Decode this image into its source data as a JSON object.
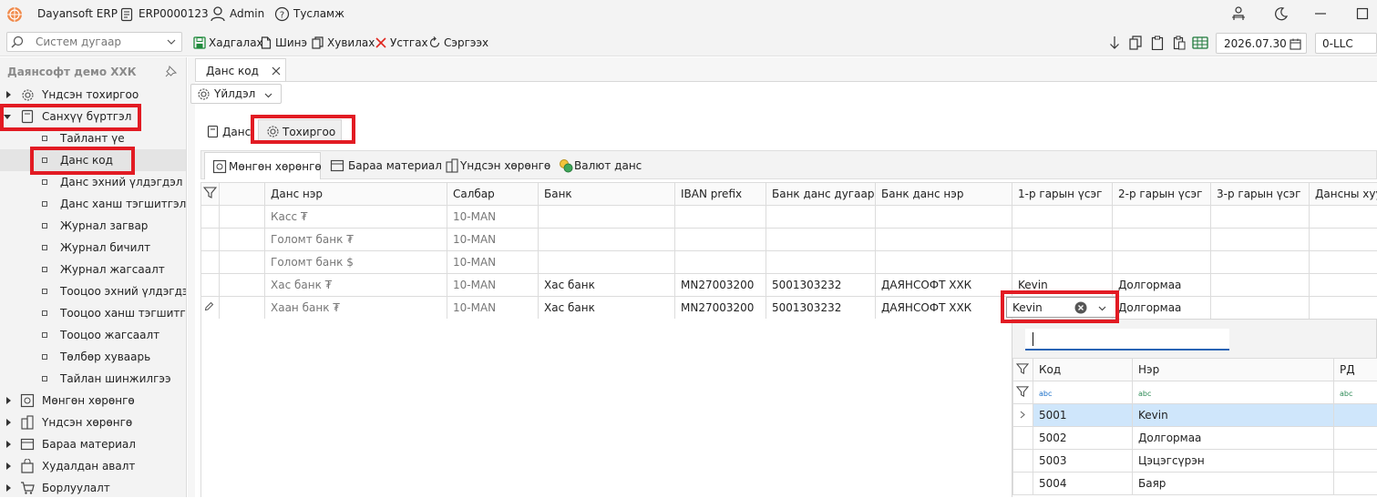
{
  "app": {
    "name": "Dayansoft ERP",
    "document": "ERP0000123",
    "user": "Admin",
    "help": "Тусламж"
  },
  "toolbar": {
    "search_placeholder": "Систем дугаар",
    "save": "Хадгалах",
    "new": "Шинэ",
    "copy": "Хувилах",
    "delete": "Устгах",
    "refresh": "Сэргээх",
    "date": "2026.07.30",
    "company": "0-LLC"
  },
  "sidebar": {
    "title": "Даянсофт демо ХХК",
    "items": [
      {
        "label": "Үндсэн тохиргоо"
      },
      {
        "label": "Санхүү бүртгэл"
      },
      {
        "label": "Тайлант үе"
      },
      {
        "label": "Данс код"
      },
      {
        "label": "Данс эхний үлдэгдэл"
      },
      {
        "label": "Данс ханш тэгшитгэл"
      },
      {
        "label": "Журнал загвар"
      },
      {
        "label": "Журнал бичилт"
      },
      {
        "label": "Журнал жагсаалт"
      },
      {
        "label": "Тооцоо эхний үлдэгдэл"
      },
      {
        "label": "Тооцоо ханш тэгшитгэл"
      },
      {
        "label": "Тооцоо жагсаалт"
      },
      {
        "label": "Төлбөр хуваарь"
      },
      {
        "label": "Тайлан шинжилгээ"
      },
      {
        "label": "Мөнгөн хөрөнгө"
      },
      {
        "label": "Үндсэн хөрөнгө"
      },
      {
        "label": "Бараа материал"
      },
      {
        "label": "Худалдан авалт"
      },
      {
        "label": "Борлуулалт"
      }
    ]
  },
  "doc_tab": {
    "label": "Данс код"
  },
  "actions": {
    "label": "Үйлдэл"
  },
  "view_tabs": [
    {
      "label": "Данс"
    },
    {
      "label": "Тохиргоо"
    }
  ],
  "sub_tabs": [
    {
      "label": "Мөнгөн хөрөнгө"
    },
    {
      "label": "Бараа материал"
    },
    {
      "label": "Үндсэн хөрөнгө"
    },
    {
      "label": "Валют данс"
    }
  ],
  "grid": {
    "columns": [
      "Данс нэр",
      "Салбар",
      "Банк",
      "IBAN prefix",
      "Банк данс дугаар",
      "Банк данс нэр",
      "1-р гарын үсэг",
      "2-р гарын үсэг",
      "3-р гарын үсэг",
      "Дансны хуул"
    ],
    "rows": [
      [
        "Касс ₮",
        "10-MAN",
        "",
        "",
        "",
        "",
        "",
        "",
        "",
        ""
      ],
      [
        "Голомт банк ₮",
        "10-MAN",
        "",
        "",
        "",
        "",
        "",
        "",
        "",
        ""
      ],
      [
        "Голомт банк $",
        "10-MAN",
        "",
        "",
        "",
        "",
        "",
        "",
        "",
        ""
      ],
      [
        "Хас банк ₮",
        "10-MAN",
        "Хас банк",
        "MN27003200",
        "5001303232",
        "ДАЯНСОФТ ХХК",
        "Kevin",
        "Долгормаа",
        "",
        ""
      ],
      [
        "Хаан банк ₮",
        "10-MAN",
        "Хас банк",
        "MN27003200",
        "5001303232",
        "ДАЯНСОФТ ХХК",
        "Kevin",
        "Долгормаа",
        "",
        ""
      ]
    ]
  },
  "dropdown": {
    "columns": [
      "Код",
      "Нэр",
      "РД"
    ],
    "filter_glyph": "abc",
    "rows": [
      {
        "code": "5001",
        "name": "Kevin"
      },
      {
        "code": "5002",
        "name": "Долгормаа"
      },
      {
        "code": "5003",
        "name": "Цэцэгсүрэн"
      },
      {
        "code": "5004",
        "name": "Баяр"
      }
    ]
  }
}
